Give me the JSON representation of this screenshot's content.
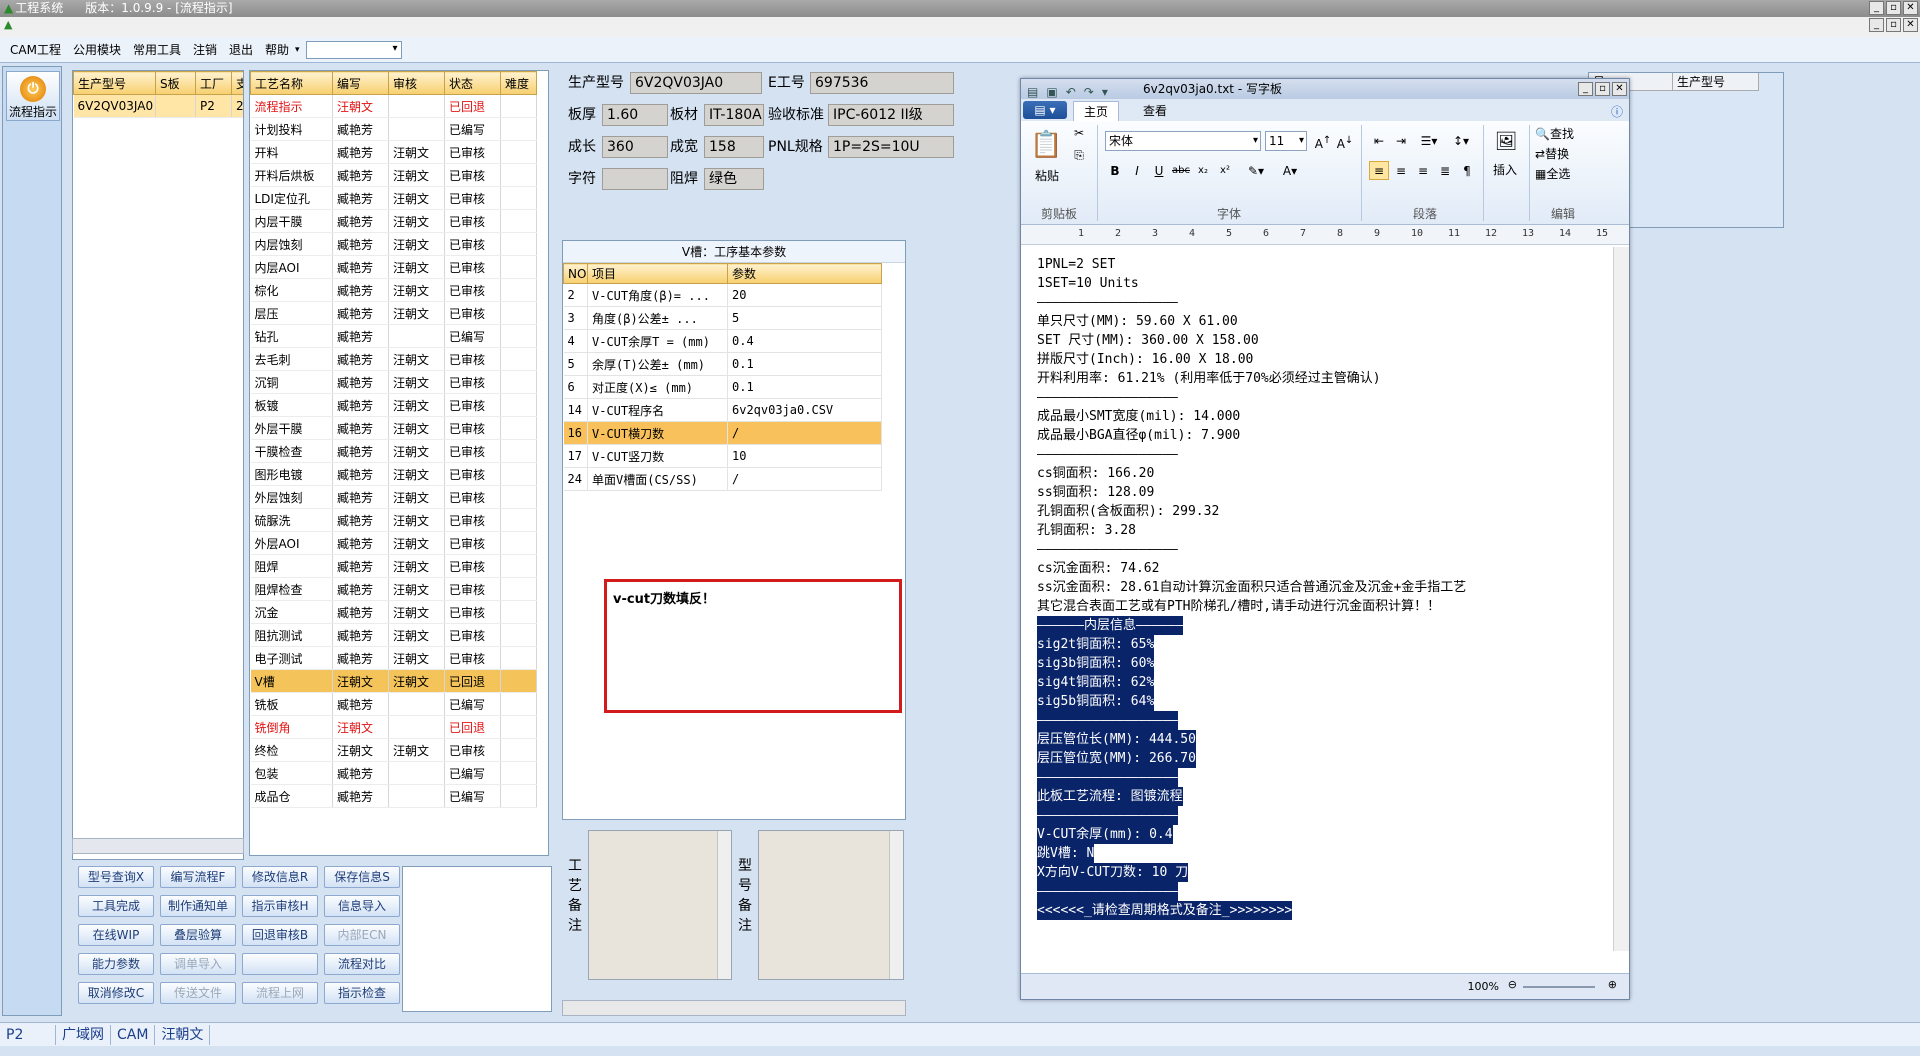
{
  "app": {
    "title": "工程系统",
    "version": "版本：1.0.9.9 - [流程指示]"
  },
  "menu": [
    "CAM工程",
    "公用模块",
    "常用工具",
    "注销",
    "退出",
    "帮助"
  ],
  "side": {
    "flow_button": "流程指示"
  },
  "models": {
    "headers": [
      "生产型号",
      "S板",
      "工厂",
      "支"
    ],
    "rows": [
      [
        "6V2QV03JA0",
        "",
        "P2",
        "2"
      ]
    ]
  },
  "process": {
    "headers": [
      "工艺名称",
      "编写",
      "审核",
      "状态",
      "难度"
    ],
    "rows": [
      [
        "流程指示",
        "汪朝文",
        "",
        "已回退",
        ""
      ],
      [
        "计划投料",
        "臧艳芳",
        "",
        "已编写",
        ""
      ],
      [
        "开料",
        "臧艳芳",
        "汪朝文",
        "已审核",
        ""
      ],
      [
        "开料后烘板",
        "臧艳芳",
        "汪朝文",
        "已审核",
        ""
      ],
      [
        "LDI定位孔",
        "臧艳芳",
        "汪朝文",
        "已审核",
        ""
      ],
      [
        "内层干膜",
        "臧艳芳",
        "汪朝文",
        "已审核",
        ""
      ],
      [
        "内层蚀刻",
        "臧艳芳",
        "汪朝文",
        "已审核",
        ""
      ],
      [
        "内层AOI",
        "臧艳芳",
        "汪朝文",
        "已审核",
        ""
      ],
      [
        "棕化",
        "臧艳芳",
        "汪朝文",
        "已审核",
        ""
      ],
      [
        "层压",
        "臧艳芳",
        "汪朝文",
        "已审核",
        ""
      ],
      [
        "钻孔",
        "臧艳芳",
        "",
        "已编写",
        ""
      ],
      [
        "去毛刺",
        "臧艳芳",
        "汪朝文",
        "已审核",
        ""
      ],
      [
        "沉铜",
        "臧艳芳",
        "汪朝文",
        "已审核",
        ""
      ],
      [
        "板镀",
        "臧艳芳",
        "汪朝文",
        "已审核",
        ""
      ],
      [
        "外层干膜",
        "臧艳芳",
        "汪朝文",
        "已审核",
        ""
      ],
      [
        "干膜检查",
        "臧艳芳",
        "汪朝文",
        "已审核",
        ""
      ],
      [
        "图形电镀",
        "臧艳芳",
        "汪朝文",
        "已审核",
        ""
      ],
      [
        "外层蚀刻",
        "臧艳芳",
        "汪朝文",
        "已审核",
        ""
      ],
      [
        "硫脲洗",
        "臧艳芳",
        "汪朝文",
        "已审核",
        ""
      ],
      [
        "外层AOI",
        "臧艳芳",
        "汪朝文",
        "已审核",
        ""
      ],
      [
        "阻焊",
        "臧艳芳",
        "汪朝文",
        "已审核",
        ""
      ],
      [
        "阻焊检查",
        "臧艳芳",
        "汪朝文",
        "已审核",
        ""
      ],
      [
        "沉金",
        "臧艳芳",
        "汪朝文",
        "已审核",
        ""
      ],
      [
        "阻抗测试",
        "臧艳芳",
        "汪朝文",
        "已审核",
        ""
      ],
      [
        "电子测试",
        "臧艳芳",
        "汪朝文",
        "已审核",
        ""
      ],
      [
        "V槽",
        "汪朝文",
        "汪朝文",
        "已回退",
        ""
      ],
      [
        "铣板",
        "臧艳芳",
        "",
        "已编写",
        ""
      ],
      [
        "铣倒角",
        "汪朝文",
        "",
        "已回退",
        ""
      ],
      [
        "终检",
        "汪朝文",
        "汪朝文",
        "已审核",
        ""
      ],
      [
        "包装",
        "臧艳芳",
        "",
        "已编写",
        ""
      ],
      [
        "成品仓",
        "臧艳芳",
        "",
        "已编写",
        ""
      ]
    ]
  },
  "buttons": [
    [
      "型号查询X",
      "编写流程F",
      "修改信息R",
      "保存信息S"
    ],
    [
      "工具完成",
      "制作通知单",
      "指示审核H",
      "信息导入"
    ],
    [
      "在线WIP",
      "叠层验算",
      "回退审核B",
      "内部ECN"
    ],
    [
      "能力参数",
      "调单导入",
      "",
      "流程对比"
    ],
    [
      "取消修改C",
      "传送文件",
      "流程上网",
      "指示检查"
    ]
  ],
  "product": {
    "model_label": "生产型号",
    "model": "6V2QV03JA0",
    "eng_label": "E工号",
    "eng": "697536",
    "thick_label": "板厚",
    "thick": "1.60",
    "mat_label": "板材",
    "mat": "IT-180A",
    "std_label": "验收标准",
    "std": "IPC-6012 II级",
    "len_label": "成长",
    "len": "360",
    "wid_label": "成宽",
    "wid": "158",
    "pnl_label": "PNL规格",
    "pnl": "1P=2S=10U",
    "char_label": "字符",
    "char": "",
    "mask_label": "阻焊",
    "mask": "绿色"
  },
  "vcut": {
    "title": "V槽：工序基本参数",
    "headers": [
      "NO",
      "项目",
      "参数"
    ],
    "rows": [
      [
        "2",
        "V-CUT角度(β)= ...",
        "20"
      ],
      [
        "3",
        "角度(β)公差± ...",
        "5"
      ],
      [
        "4",
        "V-CUT余厚T = (mm)",
        "0.4"
      ],
      [
        "5",
        "余厚(T)公差± (mm)",
        "0.1"
      ],
      [
        "6",
        "对正度(X)≤ (mm)",
        "0.1"
      ],
      [
        "14",
        "V-CUT程序名",
        "6v2qv03ja0.CSV"
      ],
      [
        "16",
        "V-CUT横刀数",
        "/"
      ],
      [
        "17",
        "V-CUT竖刀数",
        "10"
      ],
      [
        "24",
        "单面V槽面(CS/SS)",
        "/"
      ]
    ]
  },
  "popup": "v-cut刀数填反！",
  "notes": {
    "craft": [
      "工",
      "艺",
      "备",
      "注"
    ],
    "model": [
      "型",
      "号",
      "备",
      "注"
    ]
  },
  "right_header": [
    "号",
    "生产型号"
  ],
  "wordpad": {
    "title": "6v2qv03ja0.txt - 写字板",
    "tabs": [
      "主页",
      "查看"
    ],
    "font": "宋体",
    "size": "11",
    "groups": {
      "clipboard": "剪贴板",
      "font": "字体",
      "paragraph": "段落",
      "edit": "编辑"
    },
    "paste": "粘贴",
    "insert": "插入",
    "find": "查找",
    "replace": "替换",
    "selall": "全选",
    "zoom": "100%",
    "lines": [
      [
        "1PNL=2 SET",
        0
      ],
      [
        "1SET=10 Units",
        0
      ],
      [
        "——————————————————",
        0
      ],
      [
        "单只尺寸(MM): 59.60 X 61.00",
        0
      ],
      [
        "SET 尺寸(MM): 360.00 X 158.00",
        0
      ],
      [
        "拼版尺寸(Inch): 16.00 X 18.00",
        0
      ],
      [
        "开料利用率: 61.21% (利用率低于70%必须经过主管确认)",
        0
      ],
      [
        "——————————————————",
        0
      ],
      [
        "成品最小SMT宽度(mil): 14.000",
        0
      ],
      [
        "成品最小BGA直径φ(mil): 7.900",
        0
      ],
      [
        "——————————————————",
        0
      ],
      [
        "cs铜面积: 166.20",
        0
      ],
      [
        "ss铜面积: 128.09",
        0
      ],
      [
        "孔铜面积(含板面积): 299.32",
        0
      ],
      [
        "孔铜面积: 3.28",
        0
      ],
      [
        "——————————————————",
        0
      ],
      [
        "cs沉金面积: 74.62",
        0
      ],
      [
        "ss沉金面积: 28.61自动计算沉金面积只适合普通沉金及沉金+金手指工艺",
        0
      ],
      [
        "其它混合表面工艺或有PTH阶梯孔/槽时,请手动进行沉金面积计算！！",
        0
      ],
      [
        "——————内层信息——————",
        1
      ],
      [
        "sig2t铜面积: 65%",
        1
      ],
      [
        "sig3b铜面积: 60%",
        1
      ],
      [
        "sig4t铜面积: 62%",
        1
      ],
      [
        "sig5b铜面积: 64%",
        1
      ],
      [
        "——————————————————",
        1
      ],
      [
        "层压管位长(MM): 444.50",
        1
      ],
      [
        "层压管位宽(MM): 266.70",
        1
      ],
      [
        "——————————————————",
        1
      ],
      [
        "此板工艺流程: 图镀流程",
        1
      ],
      [
        "——————————————————",
        1
      ],
      [
        "V-CUT余厚(mm): 0.4",
        1
      ],
      [
        "跳V槽: N",
        1
      ],
      [
        "X方向V-CUT刀数: 10 刀",
        1
      ],
      [
        "——————————————————",
        1
      ],
      [
        "<<<<<<_请检查周期格式及备注_>>>>>>>>",
        1
      ]
    ]
  },
  "status": [
    "P2",
    "广域网",
    "CAM",
    "汪朝文"
  ]
}
